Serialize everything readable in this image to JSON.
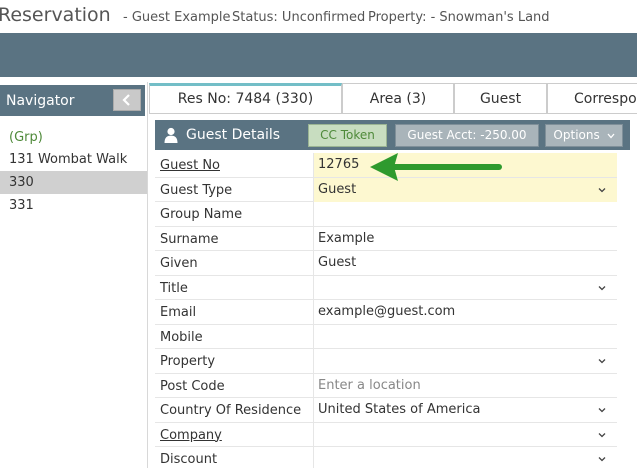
{
  "header": {
    "title": "Reservation",
    "guest": "- Guest Example",
    "status": "Status: Unconfirmed",
    "property": "Property: - Snowman's Land"
  },
  "navigator": {
    "title": "Navigator",
    "collapse_icon": "chevron-left-icon",
    "items": [
      {
        "label": "(Grp)"
      },
      {
        "label": "131 Wombat Walk"
      },
      {
        "label": "330"
      },
      {
        "label": "331"
      }
    ]
  },
  "tabs": [
    {
      "label": "Res No: 7484 (330)"
    },
    {
      "label": "Area (3)"
    },
    {
      "label": "Guest"
    },
    {
      "label": "Correspo"
    }
  ],
  "panel": {
    "title": "Guest Details",
    "cc_token": "CC Token",
    "guest_acct": "Guest Acct: -250.00",
    "options": "Options"
  },
  "fields": [
    {
      "label": "Guest No",
      "value": "12765"
    },
    {
      "label": "Guest Type",
      "value": "Guest"
    },
    {
      "label": "Group Name",
      "value": ""
    },
    {
      "label": "Surname",
      "value": "Example"
    },
    {
      "label": "Given",
      "value": "Guest"
    },
    {
      "label": "Title",
      "value": ""
    },
    {
      "label": "Email",
      "value": "example@guest.com"
    },
    {
      "label": "Mobile",
      "value": ""
    },
    {
      "label": "Property",
      "value": ""
    },
    {
      "label": "Post Code",
      "placeholder": "Enter a location"
    },
    {
      "label": "Country Of Residence",
      "value": "United States of America"
    },
    {
      "label": "Company",
      "value": ""
    },
    {
      "label": "Discount",
      "value": ""
    }
  ],
  "colors": {
    "bar": "#5a7382",
    "highlight": "#fdf8d0",
    "grp_green": "#4f8a3a",
    "arrow_green": "#2e9a2e",
    "tab_accent": "#73bec7"
  }
}
